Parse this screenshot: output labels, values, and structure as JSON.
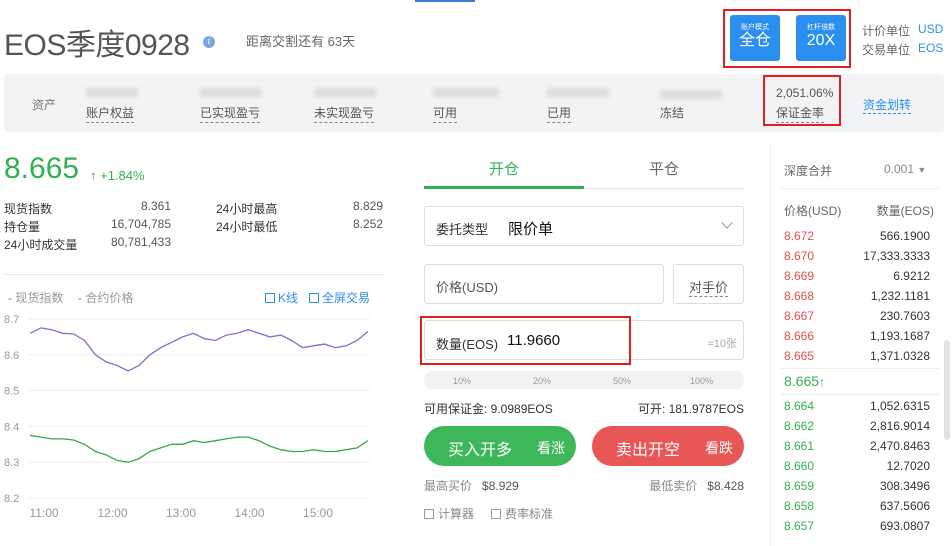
{
  "header": {
    "title": "EOS季度0928",
    "info_icon": "i",
    "delivery_text": "距离交割还有 63天",
    "account_mode": {
      "label": "账户模式",
      "value": "全仓"
    },
    "leverage": {
      "label": "杠杆倍数",
      "value": "20X"
    },
    "pricing_unit_label": "计价单位",
    "pricing_unit_value": "USD",
    "trading_unit_label": "交易单位",
    "trading_unit_value": "EOS"
  },
  "assets": {
    "label": "资产",
    "items": [
      "账户权益",
      "已实现盈亏",
      "未实现盈亏",
      "可用",
      "已用",
      "冻结"
    ],
    "margin_ratio_value": "2,051.06%",
    "margin_ratio_label": "保证金率",
    "transfer_link": "资金划转"
  },
  "ticker": {
    "last_price": "8.665",
    "change_arrow": "↑",
    "change": "+1.84%",
    "stats_left": [
      {
        "label": "现货指数",
        "value": "8.361"
      },
      {
        "label": "持仓量",
        "value": "16,704,785"
      },
      {
        "label": "24小时成交量",
        "value": "80,781,433"
      }
    ],
    "stats_right": [
      {
        "label": "24小时最高",
        "value": "8.829"
      },
      {
        "label": "24小时最低",
        "value": "8.252"
      }
    ]
  },
  "chart_links": {
    "kline": "K线",
    "fullscreen": "全屏交易"
  },
  "chart_data": {
    "type": "line",
    "legend": [
      "现货指数",
      "合约价格"
    ],
    "x_ticks": [
      "11:00",
      "12:00",
      "13:00",
      "14:00",
      "15:00"
    ],
    "y_ticks": [
      "8.7",
      "8.6",
      "8.5",
      "8.4",
      "8.3",
      "8.2"
    ],
    "ylim": [
      8.2,
      8.7
    ],
    "grid": true,
    "series": [
      {
        "name": "合约价格",
        "color": "#7b6fd0",
        "values": [
          8.66,
          8.675,
          8.67,
          8.66,
          8.658,
          8.64,
          8.6,
          8.58,
          8.57,
          8.555,
          8.57,
          8.6,
          8.62,
          8.635,
          8.65,
          8.66,
          8.645,
          8.64,
          8.655,
          8.66,
          8.67,
          8.66,
          8.65,
          8.655,
          8.64,
          8.62,
          8.625,
          8.63,
          8.62,
          8.625,
          8.64,
          8.665
        ]
      },
      {
        "name": "现货指数",
        "color": "#3ea64a",
        "values": [
          8.375,
          8.37,
          8.365,
          8.365,
          8.362,
          8.35,
          8.33,
          8.32,
          8.305,
          8.3,
          8.31,
          8.33,
          8.34,
          8.35,
          8.35,
          8.36,
          8.355,
          8.36,
          8.365,
          8.37,
          8.37,
          8.36,
          8.345,
          8.335,
          8.33,
          8.33,
          8.335,
          8.33,
          8.33,
          8.335,
          8.34,
          8.36
        ]
      }
    ]
  },
  "order": {
    "tab_open": "开仓",
    "tab_close": "平仓",
    "order_type_label": "委托类型",
    "order_type_value": "限价单",
    "price_placeholder": "价格(USD)",
    "counterparty_btn": "对手价",
    "qty_label": "数量(EOS)",
    "qty_value": "11.9660",
    "qty_hint": "≈10张",
    "percentages": [
      "10%",
      "20%",
      "50%",
      "100%"
    ],
    "available_margin": "可用保证金: 9.0989EOS",
    "can_open": "可开: 181.9787EOS",
    "buy_label": "买入开多",
    "buy_sub": "看涨",
    "sell_label": "卖出开空",
    "sell_sub": "看跌",
    "best_bid_label": "最高买价",
    "best_bid": "$8.929",
    "best_ask_label": "最低卖价",
    "best_ask": "$8.428",
    "calculator": "计算器",
    "fee_standard": "费率标准"
  },
  "orderbook": {
    "depth_label": "深度合并",
    "depth_value": "0.001",
    "col_price": "价格(USD)",
    "col_qty": "数量(EOS)",
    "asks": [
      {
        "price": "8.672",
        "qty": "566.1900"
      },
      {
        "price": "8.670",
        "qty": "17,333.3333"
      },
      {
        "price": "8.669",
        "qty": "6.9212"
      },
      {
        "price": "8.668",
        "qty": "1,232.1181"
      },
      {
        "price": "8.667",
        "qty": "230.7603"
      },
      {
        "price": "8.666",
        "qty": "1,193.1687"
      },
      {
        "price": "8.665",
        "qty": "1,371.0328"
      }
    ],
    "mid_price": "8.665",
    "mid_arrow": "↑",
    "bids": [
      {
        "price": "8.664",
        "qty": "1,052.6315"
      },
      {
        "price": "8.662",
        "qty": "2,816.9014"
      },
      {
        "price": "8.661",
        "qty": "2,470.8463"
      },
      {
        "price": "8.660",
        "qty": "12.7020"
      },
      {
        "price": "8.659",
        "qty": "308.3496"
      },
      {
        "price": "8.658",
        "qty": "637.5606"
      },
      {
        "price": "8.657",
        "qty": "693.0807"
      }
    ]
  }
}
